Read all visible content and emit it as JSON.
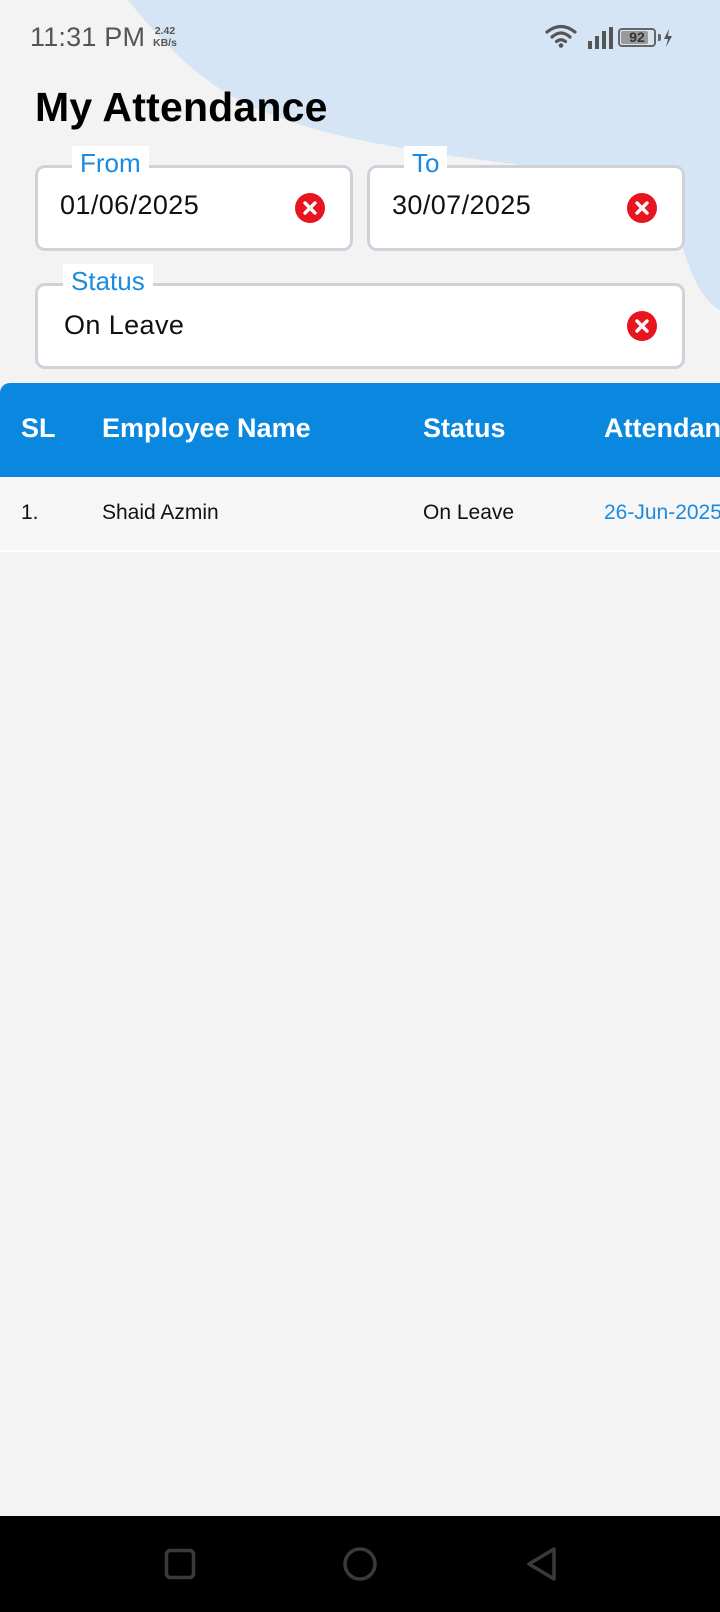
{
  "status_bar": {
    "time": "11:31 PM",
    "net_speed_value": "2.42",
    "net_speed_unit": "KB/s",
    "battery_level": "92",
    "battery_fraction": 0.92,
    "icons": [
      "wifi-icon",
      "signal-icon",
      "battery-icon",
      "charging-icon"
    ]
  },
  "page": {
    "title": "My Attendance"
  },
  "filters": {
    "from": {
      "label": "From",
      "value": "01/06/2025"
    },
    "to": {
      "label": "To",
      "value": "30/07/2025"
    },
    "status": {
      "label": "Status",
      "value": "On Leave"
    }
  },
  "table": {
    "headers": [
      "SL",
      "Employee Name",
      "Status",
      "Attendan"
    ],
    "rows": [
      {
        "sl": "1.",
        "name": "Shaid Azmin",
        "status": "On Leave",
        "date": "26-Jun-2025"
      }
    ]
  },
  "nav": {
    "icons": [
      "recent-apps-icon",
      "home-icon",
      "back-icon"
    ]
  },
  "colors": {
    "accent": "#0a88e0",
    "label": "#1a8be0",
    "clear": "#e8141f",
    "background": "#f3f3f3",
    "blob": "#d6e5f5"
  }
}
